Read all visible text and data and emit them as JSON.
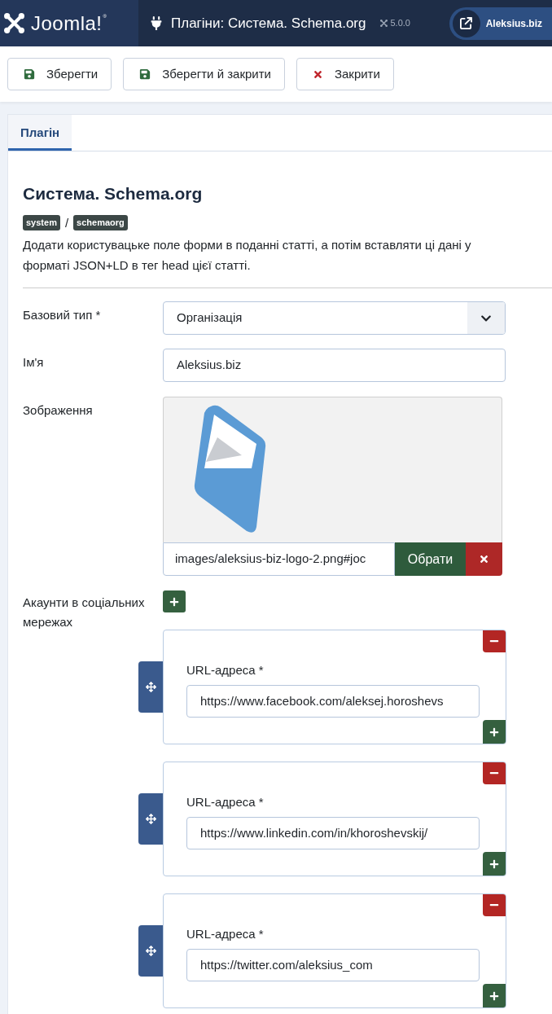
{
  "header": {
    "logo_text": "Joomla!",
    "logo_mark": "®",
    "title": "Плагіни: Система. Schema.org",
    "version": "5.0.0",
    "site_button": "Aleksius.biz"
  },
  "toolbar": [
    {
      "kind": "save",
      "label": "Зберегти"
    },
    {
      "kind": "save_close",
      "label": "Зберегти й закрити"
    },
    {
      "kind": "close",
      "label": "Закрити"
    }
  ],
  "tabs": [
    {
      "label": "Плагін",
      "selected": true
    }
  ],
  "plugin": {
    "title": "Система. Schema.org",
    "tags": [
      "system",
      "schemaorg"
    ],
    "tag_separator": "/",
    "description": "Додати користувацьке поле форми в поданні статті, а потім вставляти ці дані у форматі JSON+LD в тег head цієї статті."
  },
  "fields": [
    {
      "kind": "select",
      "label": "Базовий тип *",
      "value": "Організація"
    },
    {
      "kind": "text",
      "label": "Ім'я",
      "value": "Aleksius.biz"
    },
    {
      "kind": "media",
      "label": "Зображення",
      "value": "images/aleksius-biz-logo-2.png#joc",
      "select_button": "Обрати"
    }
  ],
  "social": {
    "label": "Акаунти в соціальних мережах",
    "rows": [
      {
        "label": "URL-адреса *",
        "value": "https://www.facebook.com/aleksej.horoshevs"
      },
      {
        "label": "URL-адреса *",
        "value": "https://www.linkedin.com/in/khoroshevskij/"
      },
      {
        "label": "URL-адреса *",
        "value": "https://twitter.com/aleksius_com"
      }
    ]
  }
}
